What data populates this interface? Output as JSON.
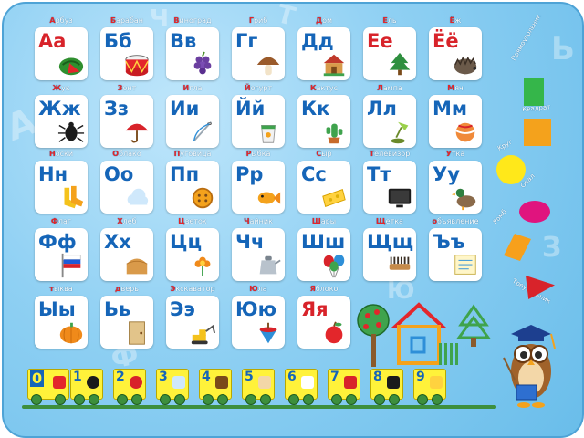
{
  "cards": [
    {
      "word": "Арбуз",
      "letters": "Аа",
      "icon": "watermelon"
    },
    {
      "word": "Барабан",
      "letters": "Бб",
      "icon": "drum"
    },
    {
      "word": "Виноград",
      "letters": "Вв",
      "icon": "grapes"
    },
    {
      "word": "Гриб",
      "letters": "Гг",
      "icon": "mushroom"
    },
    {
      "word": "Дом",
      "letters": "Дд",
      "icon": "house"
    },
    {
      "word": "Ель",
      "letters": "Ее",
      "icon": "fir-tree"
    },
    {
      "word": "Ёж",
      "letters": "Ёё",
      "icon": "hedgehog"
    },
    {
      "word": "Жук",
      "letters": "Жж",
      "icon": "beetle"
    },
    {
      "word": "Зонт",
      "letters": "Зз",
      "icon": "umbrella"
    },
    {
      "word": "Игла",
      "letters": "Ии",
      "icon": "needle"
    },
    {
      "word": "Йогурт",
      "letters": "Йй",
      "icon": "yogurt"
    },
    {
      "word": "Кактус",
      "letters": "Кк",
      "icon": "cactus"
    },
    {
      "word": "Лампа",
      "letters": "Лл",
      "icon": "lamp"
    },
    {
      "word": "Мяч",
      "letters": "Мм",
      "icon": "ball"
    },
    {
      "word": "Носки",
      "letters": "Нн",
      "icon": "socks"
    },
    {
      "word": "Облако",
      "letters": "Оо",
      "icon": "cloud"
    },
    {
      "word": "Пуговица",
      "letters": "Пп",
      "icon": "button"
    },
    {
      "word": "Рыбка",
      "letters": "Рр",
      "icon": "fish"
    },
    {
      "word": "Сыр",
      "letters": "Сс",
      "icon": "cheese"
    },
    {
      "word": "Телевизор",
      "letters": "Тт",
      "icon": "tv"
    },
    {
      "word": "Утка",
      "letters": "Уу",
      "icon": "duck"
    },
    {
      "word": "Флаг",
      "letters": "Фф",
      "icon": "flag"
    },
    {
      "word": "Хлеб",
      "letters": "Хх",
      "icon": "bread"
    },
    {
      "word": "Цветок",
      "letters": "Цц",
      "icon": "flower"
    },
    {
      "word": "Чайник",
      "letters": "Чч",
      "icon": "kettle"
    },
    {
      "word": "Шары",
      "letters": "Шш",
      "icon": "balloons"
    },
    {
      "word": "Щетка",
      "letters": "Щщ",
      "icon": "brush"
    },
    {
      "word": "объявление",
      "letters": "Ъъ",
      "icon": "notice"
    },
    {
      "word": "тыква",
      "letters": "Ыы",
      "icon": "pumpkin"
    },
    {
      "word": "дверь",
      "letters": "Ьь",
      "icon": "door"
    },
    {
      "word": "Экскаватор",
      "letters": "Ээ",
      "icon": "excavator"
    },
    {
      "word": "Юла",
      "letters": "Юю",
      "icon": "spinning-top"
    },
    {
      "word": "Яблоко",
      "letters": "Яя",
      "icon": "apple"
    }
  ],
  "shapes": [
    {
      "label": "Прямоугольник",
      "color": "#35b64a",
      "kind": "rect"
    },
    {
      "label": "Квадрат",
      "color": "#f4a21c",
      "kind": "square"
    },
    {
      "label": "Круг",
      "color": "#ffe81a",
      "kind": "circle"
    },
    {
      "label": "Овал",
      "color": "#e0147e",
      "kind": "oval"
    },
    {
      "label": "Ромб",
      "color": "#f7a01b",
      "kind": "rhombus"
    },
    {
      "label": "Треугольник",
      "color": "#d8232a",
      "kind": "triangle"
    }
  ],
  "numbers": [
    "0",
    "1",
    "2",
    "3",
    "4",
    "5",
    "6",
    "7",
    "8",
    "9"
  ],
  "colors": {
    "letter_blue": "#1565b8",
    "letter_red": "#d8232a",
    "board": "#8fd0f3"
  }
}
